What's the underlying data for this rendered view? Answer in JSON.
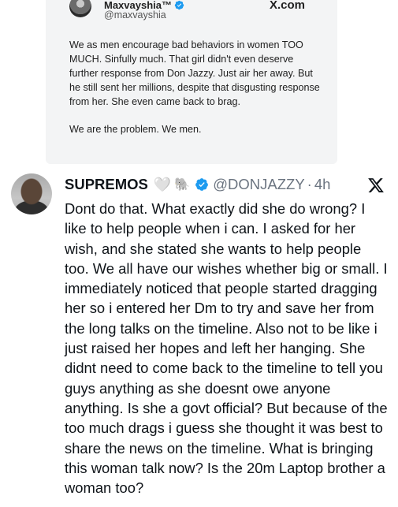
{
  "quoted": {
    "name": "Maxvayshia™",
    "handle": "@maxvayshia",
    "site": "X.com",
    "paragraphs": [
      "We as men encourage bad behaviors in women TOO MUCH. Sinfully much. That girl didn't even deserve further response from Don Jazzy. Just air her away. But he still sent her millions, despite that disgusting response from her. She even came back to brag.",
      "We are the problem. We men."
    ]
  },
  "tweet": {
    "name": "SUPREMOS",
    "handle": "@DONJAZZY",
    "separator": "·",
    "time": "4h",
    "heart": "🤍",
    "elephant": "🐘",
    "text": "Dont do that. What exactly did she do wrong? I like to help people when i can. I asked for her wish, and she stated she wants to help people too. We all have our wishes whether big or small. I immediately noticed that people started dragging her so i entered her Dm to try and save her from the long talks on the timeline. Also not to be like i just raised her hopes and left her hanging. She didnt need to come back to the timeline to tell you guys anything as she doesnt owe anyone anything. Is she a govt official? But because of the too much drags i guess she thought it was best to share the news on the timeline. What is bringing this woman talk now? Is the 20m Laptop brother a woman too?"
  },
  "colors": {
    "verified": "#1d9bf0",
    "muted": "#6b7480",
    "card_bg": "#f3f4f5"
  },
  "icons": [
    "verified-badge-icon",
    "x-logo-icon",
    "heart-icon",
    "elephant-icon"
  ]
}
